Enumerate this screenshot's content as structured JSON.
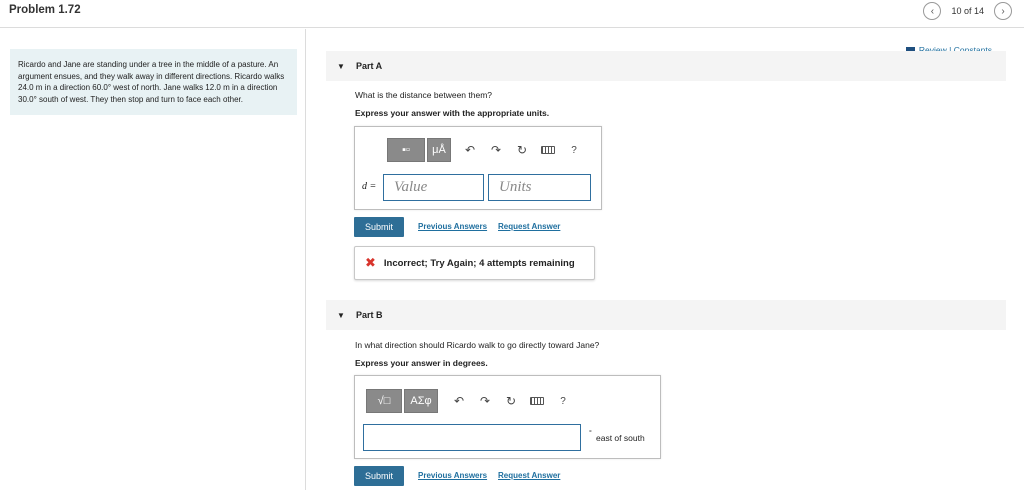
{
  "header": {
    "problem_title": "Problem 1.72",
    "pager_text": "10 of 14",
    "prev_icon": "chevron-left-icon",
    "next_icon": "chevron-right-icon"
  },
  "problem": {
    "text": "Ricardo and Jane are standing under a tree in the middle of a pasture. An argument ensues, and they walk away in different directions. Ricardo walks 24.0 m in a direction 60.0° west of north. Jane walks 12.0 m in a direction 30.0° south of west. They then stop and turn to face each other."
  },
  "review": {
    "label": "Review | Constants"
  },
  "partA": {
    "title": "Part A",
    "question": "What is the distance between them?",
    "instruction": "Express your answer with the appropriate units.",
    "toolbar": {
      "templates_label": "▪▫",
      "units_label": "μÅ"
    },
    "variable": "d =",
    "value_placeholder": "Value",
    "units_placeholder": "Units",
    "submit_label": "Submit",
    "previous_answers_label": "Previous Answers",
    "request_answer_label": "Request Answer",
    "feedback_text": "Incorrect; Try Again; 4 attempts remaining"
  },
  "partB": {
    "title": "Part B",
    "question": "In what direction should Ricardo walk to go directly toward Jane?",
    "instruction": "Express your answer in degrees.",
    "toolbar": {
      "templates_label": "√□",
      "symbols_label": "ΑΣφ"
    },
    "degree_symbol": "°",
    "unit_text": "east of south",
    "input_value": "",
    "submit_label": "Submit",
    "previous_answers_label": "Previous Answers",
    "request_answer_label": "Request Answer"
  },
  "colors": {
    "accent": "#2e6e96",
    "link": "#1f6f9f",
    "error": "#d8342c",
    "problem_bg": "#e8f2f4"
  }
}
